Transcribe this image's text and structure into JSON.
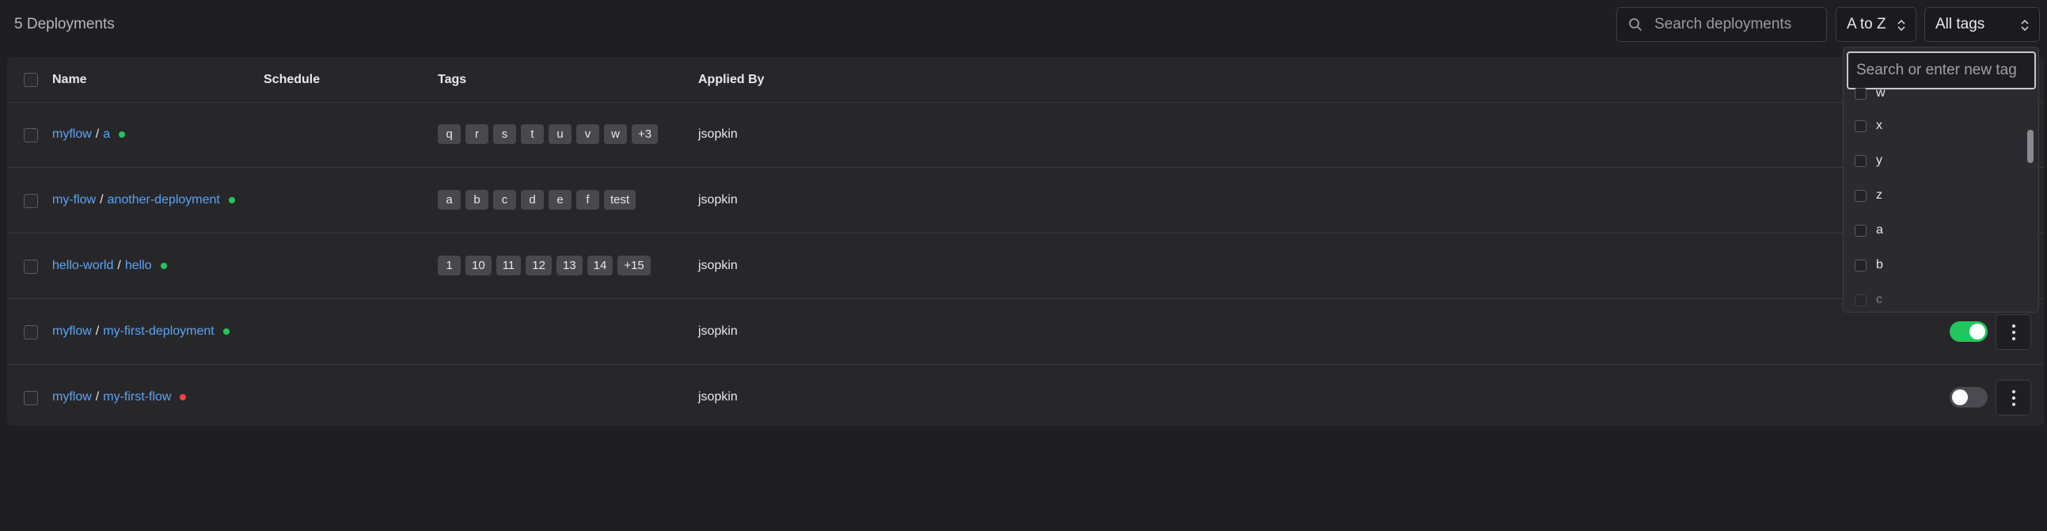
{
  "header": {
    "count_label": "5 Deployments",
    "search_placeholder": "Search deployments",
    "sort_value": "A to Z",
    "tags_filter_value": "All tags"
  },
  "table": {
    "columns": [
      "Name",
      "Schedule",
      "Tags",
      "Applied By"
    ],
    "rows": [
      {
        "flow": "myflow",
        "deployment": "a",
        "status": "green",
        "tags": [
          "q",
          "r",
          "s",
          "t",
          "u",
          "v",
          "w",
          "+3"
        ],
        "applied_by": "jsopkin",
        "toggle": null
      },
      {
        "flow": "my-flow",
        "deployment": "another-deployment",
        "status": "green",
        "tags": [
          "a",
          "b",
          "c",
          "d",
          "e",
          "f",
          "test"
        ],
        "applied_by": "jsopkin",
        "toggle": null
      },
      {
        "flow": "hello-world",
        "deployment": "hello",
        "status": "green",
        "tags": [
          "1",
          "10",
          "11",
          "12",
          "13",
          "14",
          "+15"
        ],
        "applied_by": "jsopkin",
        "toggle": null
      },
      {
        "flow": "myflow",
        "deployment": "my-first-deployment",
        "status": "green",
        "tags": [],
        "applied_by": "jsopkin",
        "toggle": "on"
      },
      {
        "flow": "myflow",
        "deployment": "my-first-flow",
        "status": "red",
        "tags": [],
        "applied_by": "jsopkin",
        "toggle": "off"
      }
    ]
  },
  "tags_dropdown": {
    "input_placeholder": "Search or enter new tag",
    "options": [
      "w",
      "x",
      "y",
      "z",
      "a",
      "b",
      "c"
    ]
  },
  "colors": {
    "link": "#5ba4f5",
    "status_green": "#22c55e",
    "status_red": "#ef4444",
    "toggle_on": "#22c55e"
  },
  "icons": {
    "search": "search-icon",
    "sort_chevrons": "chevron-up-down-icon",
    "row_menu": "kebab-menu-icon"
  }
}
